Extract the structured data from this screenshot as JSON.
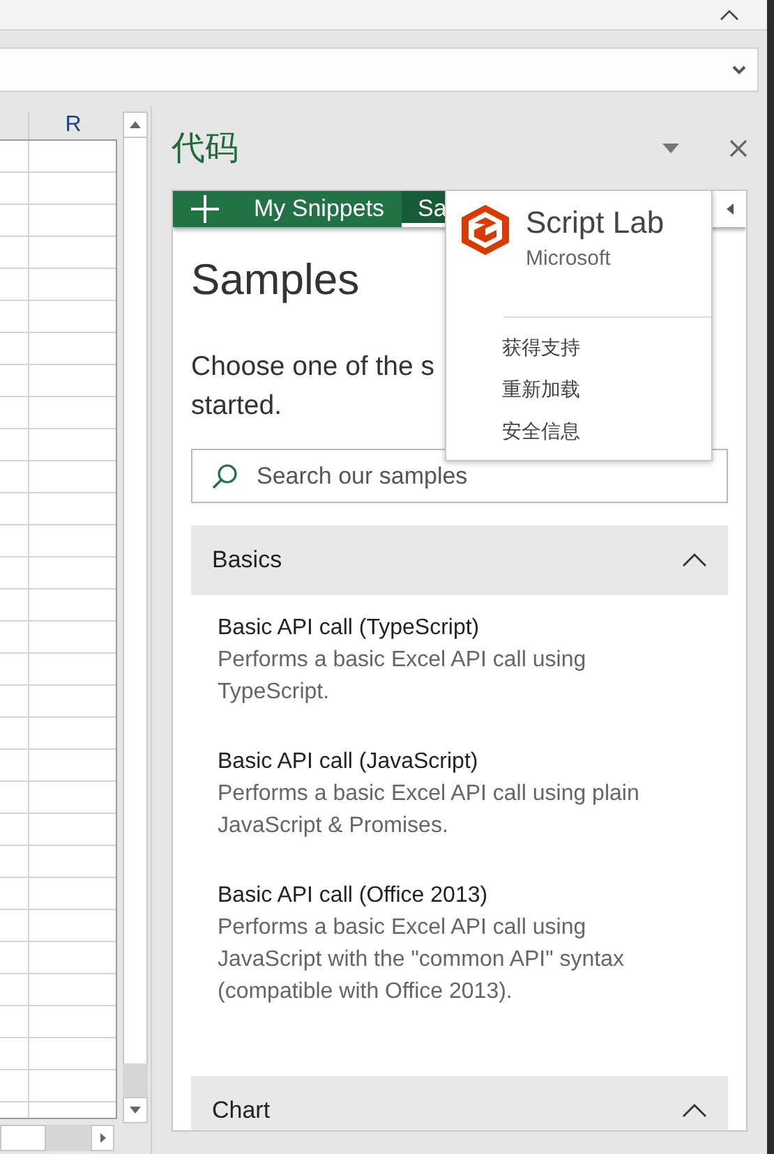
{
  "sheet": {
    "column_header": "R"
  },
  "task_pane": {
    "title": "代码"
  },
  "tabs": [
    {
      "label": "My Snippets",
      "selected": false
    },
    {
      "label": "Sa",
      "selected": true
    }
  ],
  "page_title": "Samples",
  "intro": [
    "Choose one of the s",
    "started."
  ],
  "search": {
    "placeholder": "Search our samples"
  },
  "sections": [
    {
      "title": "Basics",
      "expanded": true,
      "items": [
        {
          "title": "Basic API call (TypeScript)",
          "description": "Performs a basic Excel API call using TypeScript."
        },
        {
          "title": "Basic API call (JavaScript)",
          "description": "Performs a basic Excel API call using plain JavaScript & Promises."
        },
        {
          "title": "Basic API call (Office 2013)",
          "description": "Performs a basic Excel API call using JavaScript with the \"common API\" syntax (compatible with Office 2013)."
        }
      ]
    },
    {
      "title": "Chart",
      "expanded": true
    }
  ],
  "menu": {
    "app_name": "Script Lab",
    "publisher": "Microsoft",
    "items": [
      "获得支持",
      "重新加载",
      "安全信息"
    ]
  }
}
